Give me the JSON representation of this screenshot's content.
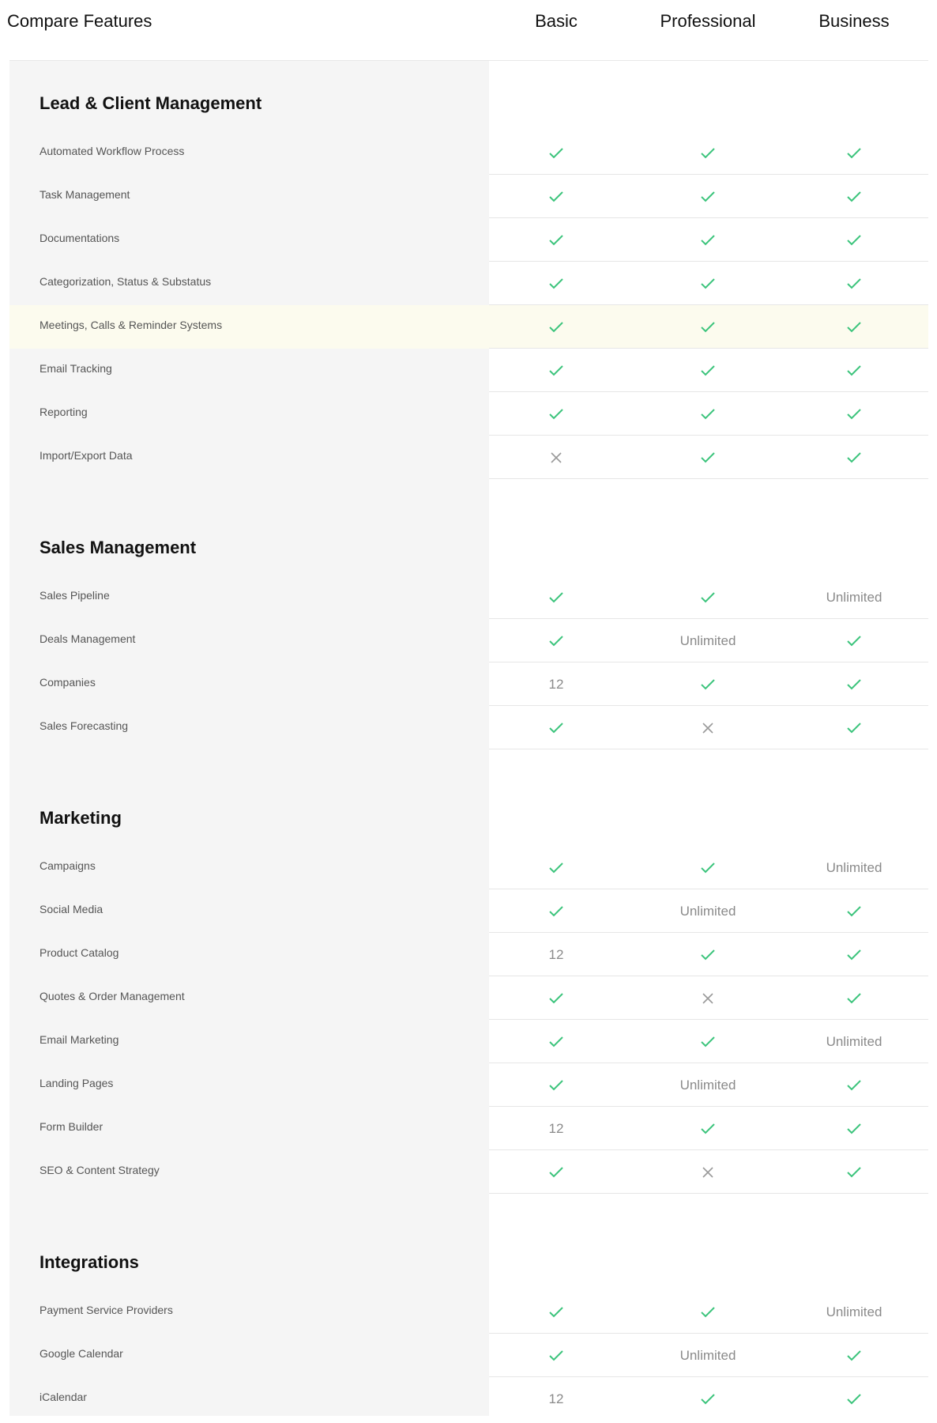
{
  "header": {
    "title": "Compare Features",
    "plans": [
      "Basic",
      "Professional",
      "Business"
    ]
  },
  "colors": {
    "check": "#3cc47c",
    "cross": "#999999",
    "highlight": "#fcfbee",
    "panel": "#f5f5f5"
  },
  "sections": [
    {
      "title": "Lead & Client Management",
      "rows": [
        {
          "label": "Automated Workflow Process",
          "values": [
            "check",
            "check",
            "check"
          ]
        },
        {
          "label": "Task Management",
          "values": [
            "check",
            "check",
            "check"
          ]
        },
        {
          "label": "Documentations",
          "values": [
            "check",
            "check",
            "check"
          ]
        },
        {
          "label": "Categorization, Status & Substatus",
          "values": [
            "check",
            "check",
            "check"
          ]
        },
        {
          "label": "Meetings, Calls & Reminder Systems",
          "values": [
            "check",
            "check",
            "check"
          ],
          "highlighted": true
        },
        {
          "label": "Email Tracking",
          "values": [
            "check",
            "check",
            "check"
          ]
        },
        {
          "label": "Reporting",
          "values": [
            "check",
            "check",
            "check"
          ]
        },
        {
          "label": "Import/Export Data",
          "values": [
            "cross",
            "check",
            "check"
          ]
        }
      ]
    },
    {
      "title": "Sales Management",
      "rows": [
        {
          "label": "Sales Pipeline",
          "values": [
            "check",
            "check",
            "Unlimited"
          ]
        },
        {
          "label": "Deals Management",
          "values": [
            "check",
            "Unlimited",
            "check"
          ]
        },
        {
          "label": "Companies",
          "values": [
            "12",
            "check",
            "check"
          ]
        },
        {
          "label": "Sales Forecasting",
          "values": [
            "check",
            "cross",
            "check"
          ]
        }
      ]
    },
    {
      "title": "Marketing",
      "rows": [
        {
          "label": "Campaigns",
          "values": [
            "check",
            "check",
            "Unlimited"
          ]
        },
        {
          "label": "Social Media",
          "values": [
            "check",
            "Unlimited",
            "check"
          ]
        },
        {
          "label": "Product Catalog",
          "values": [
            "12",
            "check",
            "check"
          ]
        },
        {
          "label": "Quotes & Order Management",
          "values": [
            "check",
            "cross",
            "check"
          ]
        },
        {
          "label": "Email Marketing",
          "values": [
            "check",
            "check",
            "Unlimited"
          ]
        },
        {
          "label": "Landing Pages",
          "values": [
            "check",
            "Unlimited",
            "check"
          ]
        },
        {
          "label": "Form Builder",
          "values": [
            "12",
            "check",
            "check"
          ]
        },
        {
          "label": "SEO & Content Strategy",
          "values": [
            "check",
            "cross",
            "check"
          ]
        }
      ]
    },
    {
      "title": "Integrations",
      "rows": [
        {
          "label": "Payment Service Providers",
          "values": [
            "check",
            "check",
            "Unlimited"
          ]
        },
        {
          "label": "Google Calendar",
          "values": [
            "check",
            "Unlimited",
            "check"
          ]
        },
        {
          "label": "iCalendar",
          "values": [
            "12",
            "check",
            "check"
          ]
        }
      ]
    }
  ]
}
